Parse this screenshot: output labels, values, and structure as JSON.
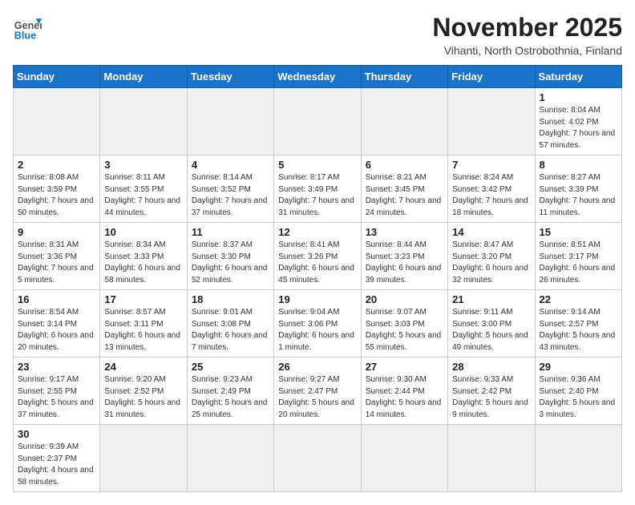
{
  "header": {
    "logo_general": "General",
    "logo_blue": "Blue",
    "month_title": "November 2025",
    "location": "Vihanti, North Ostrobothnia, Finland"
  },
  "weekdays": [
    "Sunday",
    "Monday",
    "Tuesday",
    "Wednesday",
    "Thursday",
    "Friday",
    "Saturday"
  ],
  "weeks": [
    [
      {
        "day": "",
        "info": ""
      },
      {
        "day": "",
        "info": ""
      },
      {
        "day": "",
        "info": ""
      },
      {
        "day": "",
        "info": ""
      },
      {
        "day": "",
        "info": ""
      },
      {
        "day": "",
        "info": ""
      },
      {
        "day": "1",
        "info": "Sunrise: 8:04 AM\nSunset: 4:02 PM\nDaylight: 7 hours\nand 57 minutes."
      }
    ],
    [
      {
        "day": "2",
        "info": "Sunrise: 8:08 AM\nSunset: 3:59 PM\nDaylight: 7 hours\nand 50 minutes."
      },
      {
        "day": "3",
        "info": "Sunrise: 8:11 AM\nSunset: 3:55 PM\nDaylight: 7 hours\nand 44 minutes."
      },
      {
        "day": "4",
        "info": "Sunrise: 8:14 AM\nSunset: 3:52 PM\nDaylight: 7 hours\nand 37 minutes."
      },
      {
        "day": "5",
        "info": "Sunrise: 8:17 AM\nSunset: 3:49 PM\nDaylight: 7 hours\nand 31 minutes."
      },
      {
        "day": "6",
        "info": "Sunrise: 8:21 AM\nSunset: 3:45 PM\nDaylight: 7 hours\nand 24 minutes."
      },
      {
        "day": "7",
        "info": "Sunrise: 8:24 AM\nSunset: 3:42 PM\nDaylight: 7 hours\nand 18 minutes."
      },
      {
        "day": "8",
        "info": "Sunrise: 8:27 AM\nSunset: 3:39 PM\nDaylight: 7 hours\nand 11 minutes."
      }
    ],
    [
      {
        "day": "9",
        "info": "Sunrise: 8:31 AM\nSunset: 3:36 PM\nDaylight: 7 hours\nand 5 minutes."
      },
      {
        "day": "10",
        "info": "Sunrise: 8:34 AM\nSunset: 3:33 PM\nDaylight: 6 hours\nand 58 minutes."
      },
      {
        "day": "11",
        "info": "Sunrise: 8:37 AM\nSunset: 3:30 PM\nDaylight: 6 hours\nand 52 minutes."
      },
      {
        "day": "12",
        "info": "Sunrise: 8:41 AM\nSunset: 3:26 PM\nDaylight: 6 hours\nand 45 minutes."
      },
      {
        "day": "13",
        "info": "Sunrise: 8:44 AM\nSunset: 3:23 PM\nDaylight: 6 hours\nand 39 minutes."
      },
      {
        "day": "14",
        "info": "Sunrise: 8:47 AM\nSunset: 3:20 PM\nDaylight: 6 hours\nand 32 minutes."
      },
      {
        "day": "15",
        "info": "Sunrise: 8:51 AM\nSunset: 3:17 PM\nDaylight: 6 hours\nand 26 minutes."
      }
    ],
    [
      {
        "day": "16",
        "info": "Sunrise: 8:54 AM\nSunset: 3:14 PM\nDaylight: 6 hours\nand 20 minutes."
      },
      {
        "day": "17",
        "info": "Sunrise: 8:57 AM\nSunset: 3:11 PM\nDaylight: 6 hours\nand 13 minutes."
      },
      {
        "day": "18",
        "info": "Sunrise: 9:01 AM\nSunset: 3:08 PM\nDaylight: 6 hours\nand 7 minutes."
      },
      {
        "day": "19",
        "info": "Sunrise: 9:04 AM\nSunset: 3:06 PM\nDaylight: 6 hours\nand 1 minute."
      },
      {
        "day": "20",
        "info": "Sunrise: 9:07 AM\nSunset: 3:03 PM\nDaylight: 5 hours\nand 55 minutes."
      },
      {
        "day": "21",
        "info": "Sunrise: 9:11 AM\nSunset: 3:00 PM\nDaylight: 5 hours\nand 49 minutes."
      },
      {
        "day": "22",
        "info": "Sunrise: 9:14 AM\nSunset: 2:57 PM\nDaylight: 5 hours\nand 43 minutes."
      }
    ],
    [
      {
        "day": "23",
        "info": "Sunrise: 9:17 AM\nSunset: 2:55 PM\nDaylight: 5 hours\nand 37 minutes."
      },
      {
        "day": "24",
        "info": "Sunrise: 9:20 AM\nSunset: 2:52 PM\nDaylight: 5 hours\nand 31 minutes."
      },
      {
        "day": "25",
        "info": "Sunrise: 9:23 AM\nSunset: 2:49 PM\nDaylight: 5 hours\nand 25 minutes."
      },
      {
        "day": "26",
        "info": "Sunrise: 9:27 AM\nSunset: 2:47 PM\nDaylight: 5 hours\nand 20 minutes."
      },
      {
        "day": "27",
        "info": "Sunrise: 9:30 AM\nSunset: 2:44 PM\nDaylight: 5 hours\nand 14 minutes."
      },
      {
        "day": "28",
        "info": "Sunrise: 9:33 AM\nSunset: 2:42 PM\nDaylight: 5 hours\nand 9 minutes."
      },
      {
        "day": "29",
        "info": "Sunrise: 9:36 AM\nSunset: 2:40 PM\nDaylight: 5 hours\nand 3 minutes."
      }
    ],
    [
      {
        "day": "30",
        "info": "Sunrise: 9:39 AM\nSunset: 2:37 PM\nDaylight: 4 hours\nand 58 minutes."
      },
      {
        "day": "",
        "info": ""
      },
      {
        "day": "",
        "info": ""
      },
      {
        "day": "",
        "info": ""
      },
      {
        "day": "",
        "info": ""
      },
      {
        "day": "",
        "info": ""
      },
      {
        "day": "",
        "info": ""
      }
    ]
  ]
}
